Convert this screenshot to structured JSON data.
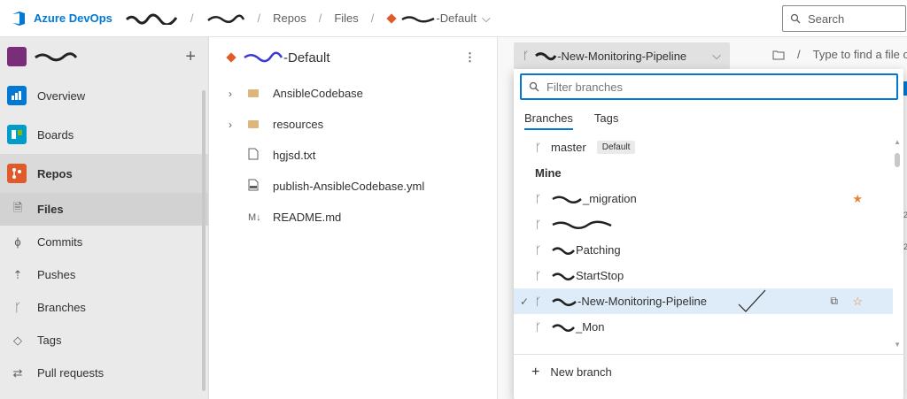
{
  "header": {
    "brand": "Azure DevOps",
    "breadcrumbs": [
      "Repos",
      "Files"
    ],
    "repo_suffix": "-Default",
    "search_placeholder": "Search"
  },
  "sidebar": {
    "nav": [
      {
        "label": "Overview",
        "icon": "overview-icon",
        "color": "#0078d4"
      },
      {
        "label": "Boards",
        "icon": "boards-icon",
        "color": "#009ccc"
      },
      {
        "label": "Repos",
        "icon": "repos-icon",
        "color": "#e05b2b"
      }
    ],
    "repo_items": [
      {
        "label": "Files",
        "icon": "files-icon"
      },
      {
        "label": "Commits",
        "icon": "commits-icon"
      },
      {
        "label": "Pushes",
        "icon": "pushes-icon"
      },
      {
        "label": "Branches",
        "icon": "branches-icon"
      },
      {
        "label": "Tags",
        "icon": "tags-icon"
      },
      {
        "label": "Pull requests",
        "icon": "pull-requests-icon"
      }
    ]
  },
  "tree": {
    "repo_suffix": "-Default",
    "items": [
      {
        "name": "AnsibleCodebase",
        "type": "folder"
      },
      {
        "name": "resources",
        "type": "folder"
      },
      {
        "name": "hgjsd.txt",
        "type": "file"
      },
      {
        "name": "publish-AnsibleCodebase.yml",
        "type": "yml"
      },
      {
        "name": "README.md",
        "type": "md"
      }
    ]
  },
  "content": {
    "branch_suffix": "-New-Monitoring-Pipeline",
    "path_sep": "/",
    "find_placeholder": "Type to find a file o"
  },
  "branch_dropdown": {
    "filter_placeholder": "Filter branches",
    "tabs": [
      "Branches",
      "Tags"
    ],
    "master": "master",
    "default_badge": "Default",
    "mine_label": "Mine",
    "branches": [
      {
        "visible": "_migration",
        "starred": true
      },
      {
        "visible": "",
        "starred": false
      },
      {
        "visible": "Patching",
        "starred": false
      },
      {
        "visible": "StartStop",
        "starred": false
      },
      {
        "visible": "-New-Monitoring-Pipeline",
        "starred": false,
        "selected": true
      },
      {
        "visible": "_Mon",
        "starred": false
      }
    ],
    "new_branch": "New branch",
    "star_color": "#e8833a",
    "accent": "#0078d4"
  }
}
